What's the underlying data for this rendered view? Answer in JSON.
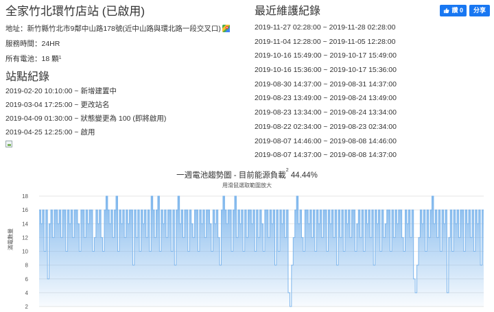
{
  "station": {
    "title": "全家竹北環竹店站 (已啟用)",
    "address_label": "地址：",
    "address": "新竹縣竹北市9鄰中山路178號(近中山路與環北路一段交叉口)",
    "hours_label": "服務時間：",
    "hours": "24HR",
    "batteries_label": "所有電池：",
    "batteries": "18 顆",
    "batteries_note": "1",
    "map_icon": "google-maps-icon"
  },
  "records": {
    "title": "站點紀錄",
    "items": [
      "2019-02-20 10:10:00 ~ 新增建置中",
      "2019-03-04 17:25:00 ~ 更改站名",
      "2019-04-09 01:30:00 ~ 狀態變更為 100 (即將啟用)",
      "2019-04-25 12:25:00 ~ 啟用"
    ]
  },
  "maintenance": {
    "title": "最近維護紀錄",
    "items": [
      "2019-11-27 02:28:00 ~ 2019-11-28 02:28:00",
      "2019-11-04 12:28:00 ~ 2019-11-05 12:28:00",
      "2019-10-16 15:49:00 ~ 2019-10-17 15:49:00",
      "2019-10-16 15:36:00 ~ 2019-10-17 15:36:00",
      "2019-08-30 14:37:00 ~ 2019-08-31 14:37:00",
      "2019-08-23 13:49:00 ~ 2019-08-24 13:49:00",
      "2019-08-23 13:34:00 ~ 2019-08-24 13:34:00",
      "2019-08-22 02:34:00 ~ 2019-08-23 02:34:00",
      "2019-08-07 14:46:00 ~ 2019-08-08 14:46:00",
      "2019-08-07 14:37:00 ~ 2019-08-08 14:37:00"
    ]
  },
  "toolbar": {
    "like_label": "讚 0",
    "share_label": "分享",
    "like_icon": "thumbs-up-icon"
  },
  "chart": {
    "title": "一週電池趨勢圖 - 目前能源負載",
    "title_note": "2",
    "title_value": "44.44%",
    "subtitle": "用滑鼠選取範圍放大",
    "ylabel": "滿電數量"
  },
  "chart_data": {
    "type": "area",
    "ylim": [
      2,
      18
    ],
    "yticks": [
      2,
      4,
      6,
      8,
      10,
      12,
      14,
      16,
      18
    ],
    "grid": true,
    "color": "#7cb5ec",
    "values": [
      16,
      14,
      16,
      10,
      16,
      6,
      14,
      16,
      12,
      16,
      16,
      14,
      16,
      12,
      16,
      16,
      10,
      16,
      14,
      16,
      12,
      16,
      16,
      14,
      10,
      16,
      16,
      12,
      16,
      14,
      16,
      16,
      10,
      12,
      16,
      14,
      16,
      12,
      10,
      16,
      18,
      16,
      14,
      16,
      12,
      16,
      18,
      10,
      16,
      14,
      16,
      12,
      16,
      14,
      16,
      16,
      8,
      16,
      12,
      16,
      10,
      16,
      14,
      16,
      12,
      16,
      10,
      18,
      16,
      12,
      16,
      18,
      10,
      16,
      14,
      16,
      12,
      16,
      16,
      10,
      16,
      8,
      16,
      18,
      14,
      16,
      12,
      16,
      16,
      10,
      16,
      14,
      12,
      16,
      16,
      10,
      16,
      14,
      16,
      12,
      16,
      16,
      14,
      10,
      16,
      14,
      16,
      12,
      8,
      16,
      18,
      16,
      14,
      16,
      16,
      10,
      16,
      18,
      12,
      16,
      14,
      16,
      10,
      16,
      12,
      16,
      16,
      14,
      16,
      10,
      16,
      12,
      16,
      14,
      10,
      16,
      16,
      12,
      16,
      14,
      16,
      8,
      16,
      10,
      16,
      14,
      16,
      12,
      16,
      4,
      2,
      8,
      12,
      16,
      18,
      14,
      16,
      12,
      10,
      16,
      16,
      14,
      16,
      12,
      16,
      10,
      16,
      14,
      16,
      12,
      16,
      16,
      10,
      16,
      14,
      16,
      12,
      16,
      8,
      16,
      12,
      16,
      10,
      16,
      14,
      16,
      12,
      16,
      16,
      10,
      14,
      16,
      12,
      16,
      10,
      16,
      14,
      16,
      12,
      16,
      8,
      16,
      14,
      16,
      10,
      16,
      12,
      14,
      16,
      16,
      10,
      16,
      12,
      16,
      14,
      16,
      16,
      12,
      10,
      16,
      14,
      16,
      12,
      16,
      6,
      4,
      8,
      12,
      16,
      14,
      16,
      10,
      16,
      12,
      16,
      18,
      14,
      16,
      12,
      16,
      10,
      16,
      14,
      16,
      4,
      12,
      16,
      10,
      16,
      14,
      16,
      12,
      16,
      16,
      10,
      16,
      14,
      16,
      12,
      16,
      10,
      16,
      14,
      16,
      8,
      16
    ]
  }
}
